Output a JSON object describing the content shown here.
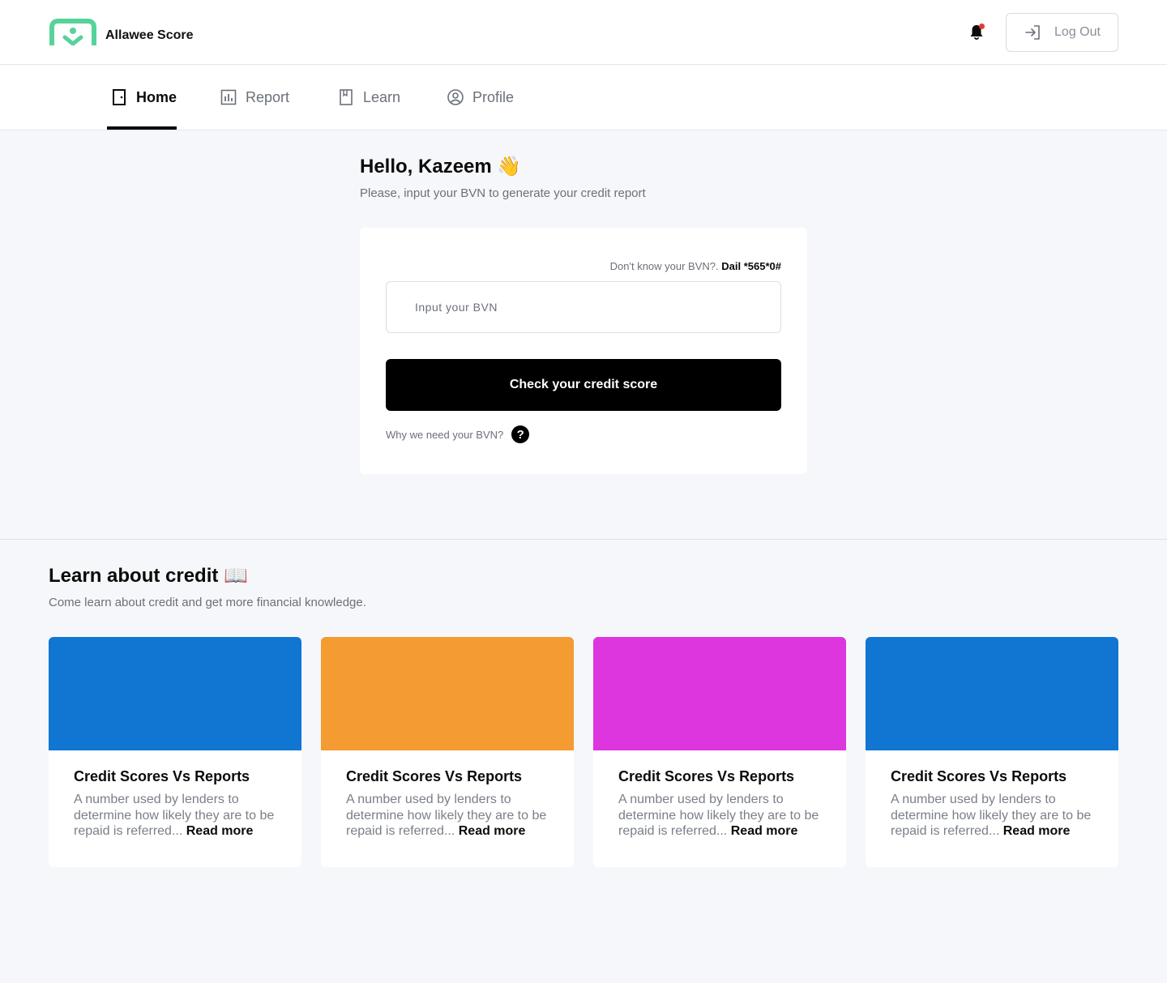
{
  "header": {
    "brand_name": "Allawee Score",
    "logout_label": "Log Out",
    "brand_color": "#56d39a",
    "notification_dot_color": "#e53935"
  },
  "nav": {
    "items": [
      {
        "label": "Home",
        "icon": "door-icon",
        "active": true
      },
      {
        "label": "Report",
        "icon": "chart-icon",
        "active": false
      },
      {
        "label": "Learn",
        "icon": "book-icon",
        "active": false
      },
      {
        "label": "Profile",
        "icon": "user-circle-icon",
        "active": false
      }
    ]
  },
  "greeting": {
    "title": "Hello, Kazeem 👋",
    "subtitle": "Please, input your BVN to generate your credit report"
  },
  "bvn_form": {
    "hint_text": "Don't know your BVN?.",
    "hint_code": "Dail *565*0#",
    "input_placeholder": "Input your BVN",
    "input_value": "",
    "submit_label": "Check your credit score",
    "why_text": "Why we need your BVN?"
  },
  "learn": {
    "title": "Learn about credit 📖",
    "subtitle": "Come learn about credit and get more financial knowledge.",
    "cards": [
      {
        "title": "Credit Scores Vs Reports",
        "text": "A number used by lenders to determine how likely they are to be repaid is referred...",
        "link": "Read more",
        "color": "#1076d1"
      },
      {
        "title": "Credit Scores Vs Reports",
        "text": "A number used by lenders to determine how likely they are to be repaid is referred...",
        "link": "Read more",
        "color": "#f49b32"
      },
      {
        "title": "Credit Scores Vs Reports",
        "text": "A number used by lenders to determine how likely they are to be repaid is referred...",
        "link": "Read more",
        "color": "#dd36de"
      },
      {
        "title": "Credit Scores Vs Reports",
        "text": "A number used by lenders to determine how likely they are to be repaid is referred...",
        "link": "Read more",
        "color": "#1076d1"
      }
    ]
  }
}
